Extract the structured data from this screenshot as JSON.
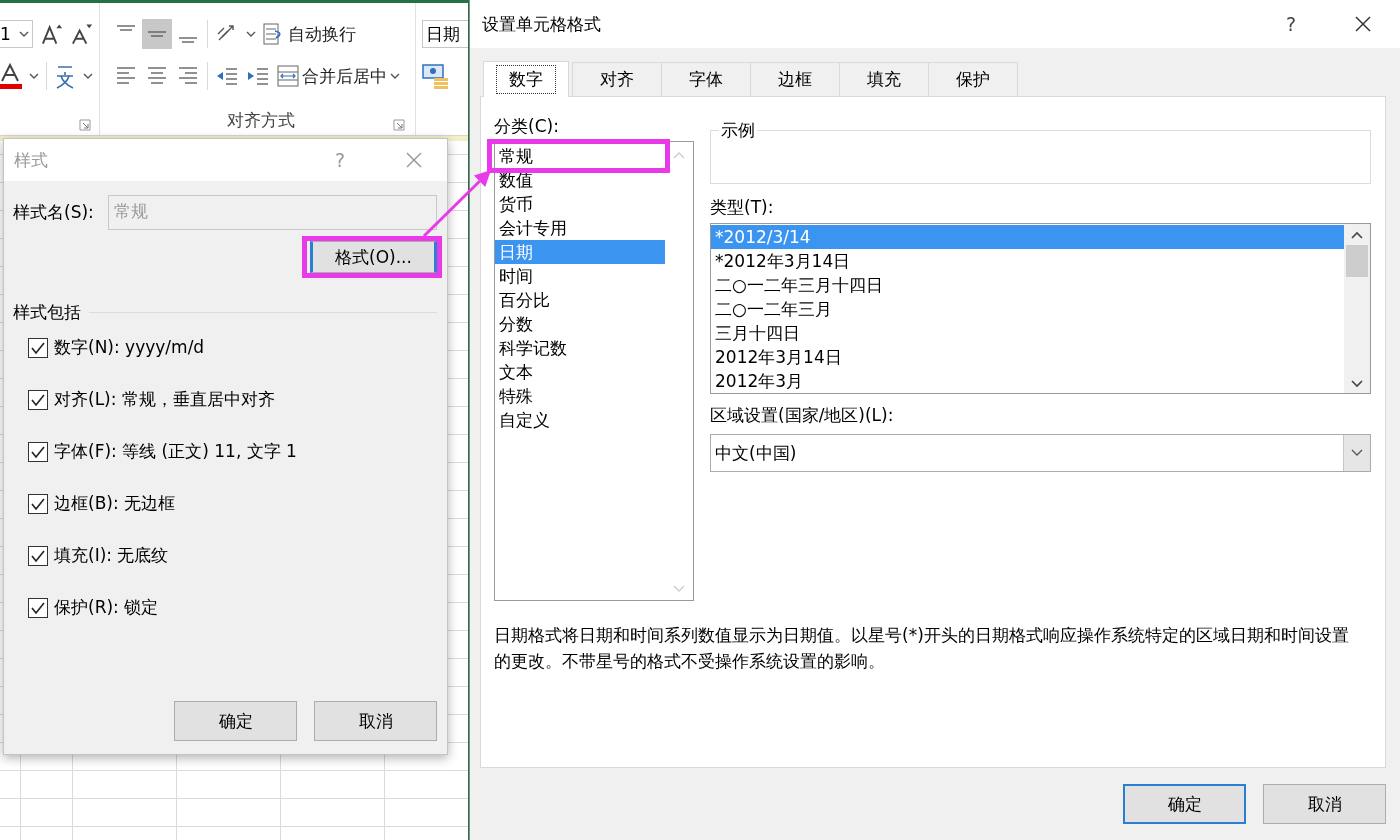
{
  "ribbon": {
    "font_size": "1",
    "vertical_align": [
      {
        "selected": false
      },
      {
        "selected": true
      },
      {
        "selected": false
      }
    ],
    "horizontal_align": [
      {
        "selected": false
      },
      {
        "selected": false
      },
      {
        "selected": false
      }
    ],
    "wrap_text": "自动换行",
    "merge_center": "合并后居中",
    "group_label": "对齐方式",
    "number_format": "日期"
  },
  "style_dialog": {
    "title": "样式",
    "help": "?",
    "name_label": "样式名(S):",
    "name_value": "常规",
    "format_button": {
      "label": "格式(O)...",
      "highlighted": true
    },
    "includes_label": "样式包括",
    "options": [
      {
        "label": "数字(N): yyyy/m/d",
        "checked": true
      },
      {
        "label": "对齐(L): 常规，垂直居中对齐",
        "checked": true
      },
      {
        "label": "字体(F): 等线 (正文) 11, 文字 1",
        "checked": true
      },
      {
        "label": "边框(B): 无边框",
        "checked": true
      },
      {
        "label": "填充(I): 无底纹",
        "checked": true
      },
      {
        "label": "保护(R): 锁定",
        "checked": true
      }
    ],
    "buttons": [
      "确定",
      "取消"
    ]
  },
  "format_dialog": {
    "title": "设置单元格格式",
    "help": "?",
    "tabs": [
      {
        "label": "数字",
        "selected": true
      },
      {
        "label": "对齐",
        "selected": false
      },
      {
        "label": "字体",
        "selected": false
      },
      {
        "label": "边框",
        "selected": false
      },
      {
        "label": "填充",
        "selected": false
      },
      {
        "label": "保护",
        "selected": false
      }
    ],
    "category_label": "分类(C):",
    "categories": [
      {
        "label": "常规",
        "selected": false,
        "highlighted": true
      },
      {
        "label": "数值",
        "selected": false,
        "highlighted": false
      },
      {
        "label": "货币",
        "selected": false,
        "highlighted": false
      },
      {
        "label": "会计专用",
        "selected": false,
        "highlighted": false
      },
      {
        "label": "日期",
        "selected": true,
        "highlighted": false
      },
      {
        "label": "时间",
        "selected": false,
        "highlighted": false
      },
      {
        "label": "百分比",
        "selected": false,
        "highlighted": false
      },
      {
        "label": "分数",
        "selected": false,
        "highlighted": false
      },
      {
        "label": "科学记数",
        "selected": false,
        "highlighted": false
      },
      {
        "label": "文本",
        "selected": false,
        "highlighted": false
      },
      {
        "label": "特殊",
        "selected": false,
        "highlighted": false
      },
      {
        "label": "自定义",
        "selected": false,
        "highlighted": false
      }
    ],
    "sample_label": "示例",
    "type_label": "类型(T):",
    "types": [
      {
        "label": "*2012/3/14",
        "selected": true
      },
      {
        "label": "*2012年3月14日",
        "selected": false
      },
      {
        "label": "二○一二年三月十四日",
        "selected": false
      },
      {
        "label": "二○一二年三月",
        "selected": false
      },
      {
        "label": "三月十四日",
        "selected": false
      },
      {
        "label": "2012年3月14日",
        "selected": false
      },
      {
        "label": "2012年3月",
        "selected": false
      }
    ],
    "locale_label": "区域设置(国家/地区)(L):",
    "locale_value": "中文(中国)",
    "description": "日期格式将日期和时间系列数值显示为日期值。以星号(*)开头的日期格式响应操作系统特定的区域日期和时间设置的更改。不带星号的格式不受操作系统设置的影响。",
    "buttons": [
      {
        "label": "确定",
        "default": true
      },
      {
        "label": "取消",
        "default": false
      }
    ]
  }
}
